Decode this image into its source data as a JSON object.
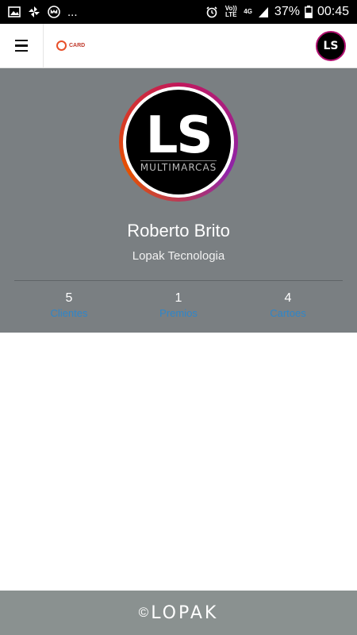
{
  "statusbar": {
    "battery": "37%",
    "time": "00:45",
    "network": "4G",
    "volte": "Vo)) LTE",
    "more": "..."
  },
  "topbar": {
    "brand": "CARD",
    "avatar_text": "LS"
  },
  "profile": {
    "avatar_text": "LS",
    "avatar_sub": "MULTIMARCAS",
    "name": "Roberto Brito",
    "company": "Lopak Tecnologia",
    "stats": [
      {
        "value": "5",
        "label": "Clientes"
      },
      {
        "value": "1",
        "label": "Premios"
      },
      {
        "value": "4",
        "label": "Cartoes"
      }
    ]
  },
  "footer": {
    "copyright": "©",
    "logo": "LOPAK"
  },
  "colors": {
    "profile_bg": "#7a7f82",
    "footer_bg": "#8a9190",
    "link": "#2f86c9",
    "ring": "#c2185b"
  }
}
